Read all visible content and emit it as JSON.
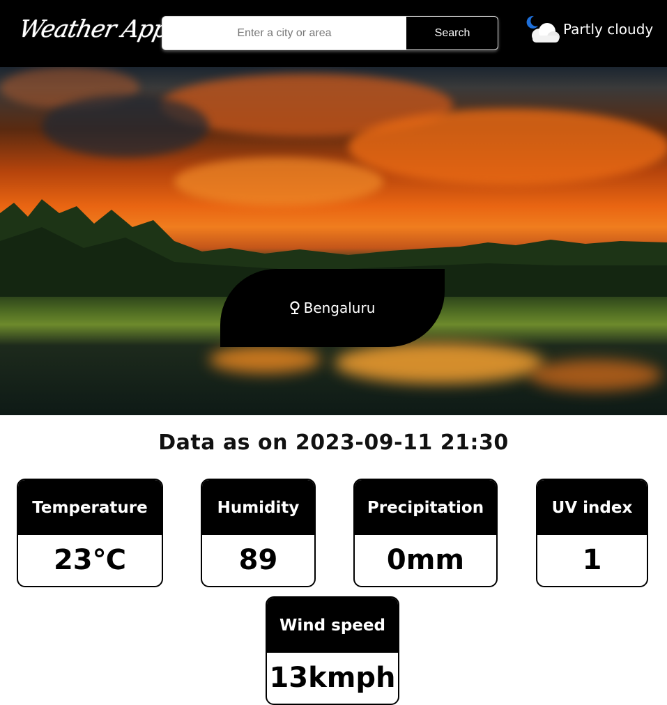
{
  "app": {
    "logo_text": "Weather App"
  },
  "search": {
    "placeholder": "Enter a city or area",
    "value": "",
    "button_label": "Search"
  },
  "current": {
    "condition_text": "Partly cloudy",
    "condition_icon": "moon-cloud-icon"
  },
  "location": {
    "icon": "map-pin-icon",
    "name": "Bengaluru"
  },
  "timestamp_heading": "Data as on 2023-09-11 21:30",
  "metrics": {
    "temperature": {
      "label": "Temperature",
      "value": "23℃"
    },
    "humidity": {
      "label": "Humidity",
      "value": "89"
    },
    "precipitation": {
      "label": "Precipitation",
      "value": "0mm"
    },
    "uv_index": {
      "label": "UV index",
      "value": "1"
    },
    "wind_speed": {
      "label": "Wind speed",
      "value": "13kmph"
    }
  },
  "colors": {
    "bar": "#000000",
    "card_header": "#000000",
    "card_border": "#000000"
  }
}
